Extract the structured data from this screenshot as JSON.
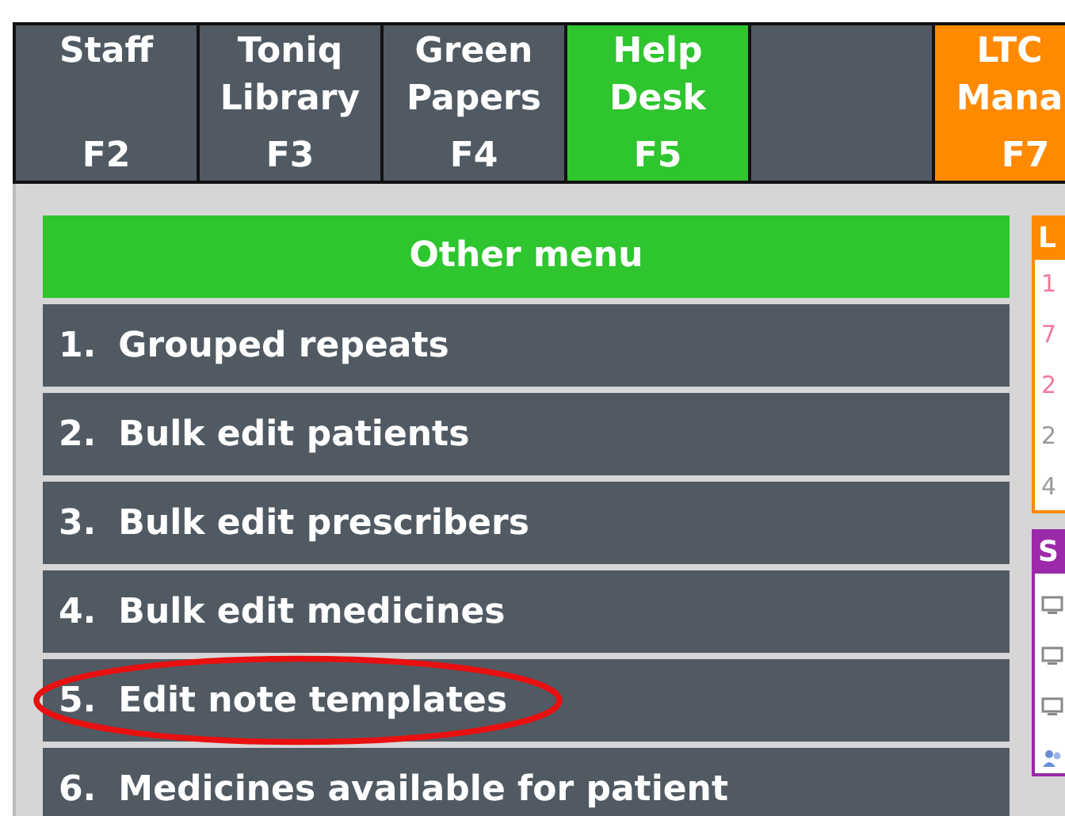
{
  "tabs": [
    {
      "label": "Staff",
      "key": "F2",
      "color": "#515a63"
    },
    {
      "label": "Toniq Library",
      "key": "F3",
      "color": "#515a63"
    },
    {
      "label": "Green Papers",
      "key": "F4",
      "color": "#515a63"
    },
    {
      "label": "Help Desk",
      "key": "F5",
      "color": "#2ec52e"
    },
    {
      "color": "#515a63"
    },
    {
      "label": "LTC Mana",
      "key": "F7",
      "color": "#ff8a00"
    }
  ],
  "menu": {
    "title": "Other menu",
    "items": [
      {
        "number": "1.",
        "label": "Grouped repeats",
        "circled": false
      },
      {
        "number": "2.",
        "label": "Bulk edit patients",
        "circled": false
      },
      {
        "number": "3.",
        "label": "Bulk edit prescribers",
        "circled": false
      },
      {
        "number": "4.",
        "label": "Bulk edit medicines",
        "circled": false
      },
      {
        "number": "5.",
        "label": "Edit note templates",
        "circled": true
      },
      {
        "number": "6.",
        "label": "Medicines available for patient",
        "circled": false
      }
    ]
  },
  "side_panels": [
    {
      "title": "L",
      "color": "#ff8a00",
      "lines": [
        {
          "text": "1",
          "color": "#f07a9a"
        },
        {
          "text": "7",
          "color": "#f07a9a"
        },
        {
          "text": "2",
          "color": "#f07a9a"
        },
        {
          "text": "2",
          "color": "#999999"
        },
        {
          "text": "4",
          "color": "#999999"
        }
      ]
    },
    {
      "title": "S",
      "color": "#9b2aa8",
      "icons": [
        {
          "kind": "screen"
        },
        {
          "kind": "screen"
        },
        {
          "kind": "screen"
        },
        {
          "kind": "people"
        }
      ]
    }
  ]
}
